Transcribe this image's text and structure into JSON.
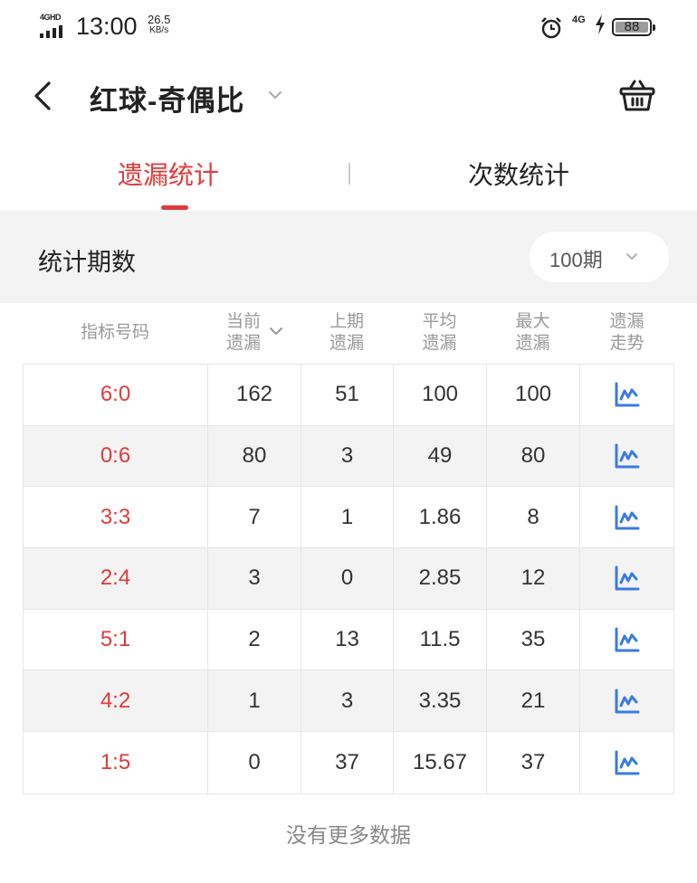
{
  "status_bar": {
    "network_label": "4GHD",
    "time": "13:00",
    "speed_value": "26.5",
    "speed_unit": "KB/s",
    "mobile_label": "4G",
    "battery": "88"
  },
  "header": {
    "title": "红球-奇偶比"
  },
  "tabs": {
    "active": "遗漏统计",
    "other": "次数统计"
  },
  "period": {
    "label": "统计期数",
    "value": "100期"
  },
  "table": {
    "headers": [
      {
        "l1": "指标号码",
        "l2": ""
      },
      {
        "l1": "当前",
        "l2": "遗漏"
      },
      {
        "l1": "上期",
        "l2": "遗漏"
      },
      {
        "l1": "平均",
        "l2": "遗漏"
      },
      {
        "l1": "最大",
        "l2": "遗漏"
      },
      {
        "l1": "遗漏",
        "l2": "走势"
      }
    ],
    "rows": [
      {
        "ratio": "6:0",
        "current": "162",
        "last": "51",
        "avg": "100",
        "max": "100"
      },
      {
        "ratio": "0:6",
        "current": "80",
        "last": "3",
        "avg": "49",
        "max": "80"
      },
      {
        "ratio": "3:3",
        "current": "7",
        "last": "1",
        "avg": "1.86",
        "max": "8"
      },
      {
        "ratio": "2:4",
        "current": "3",
        "last": "0",
        "avg": "2.85",
        "max": "12"
      },
      {
        "ratio": "5:1",
        "current": "2",
        "last": "13",
        "avg": "11.5",
        "max": "35"
      },
      {
        "ratio": "4:2",
        "current": "1",
        "last": "3",
        "avg": "3.35",
        "max": "21"
      },
      {
        "ratio": "1:5",
        "current": "0",
        "last": "37",
        "avg": "15.67",
        "max": "37"
      }
    ]
  },
  "footer": {
    "no_more": "没有更多数据"
  },
  "colors": {
    "accent": "#e23a3a",
    "trend_icon": "#3a7be2"
  }
}
